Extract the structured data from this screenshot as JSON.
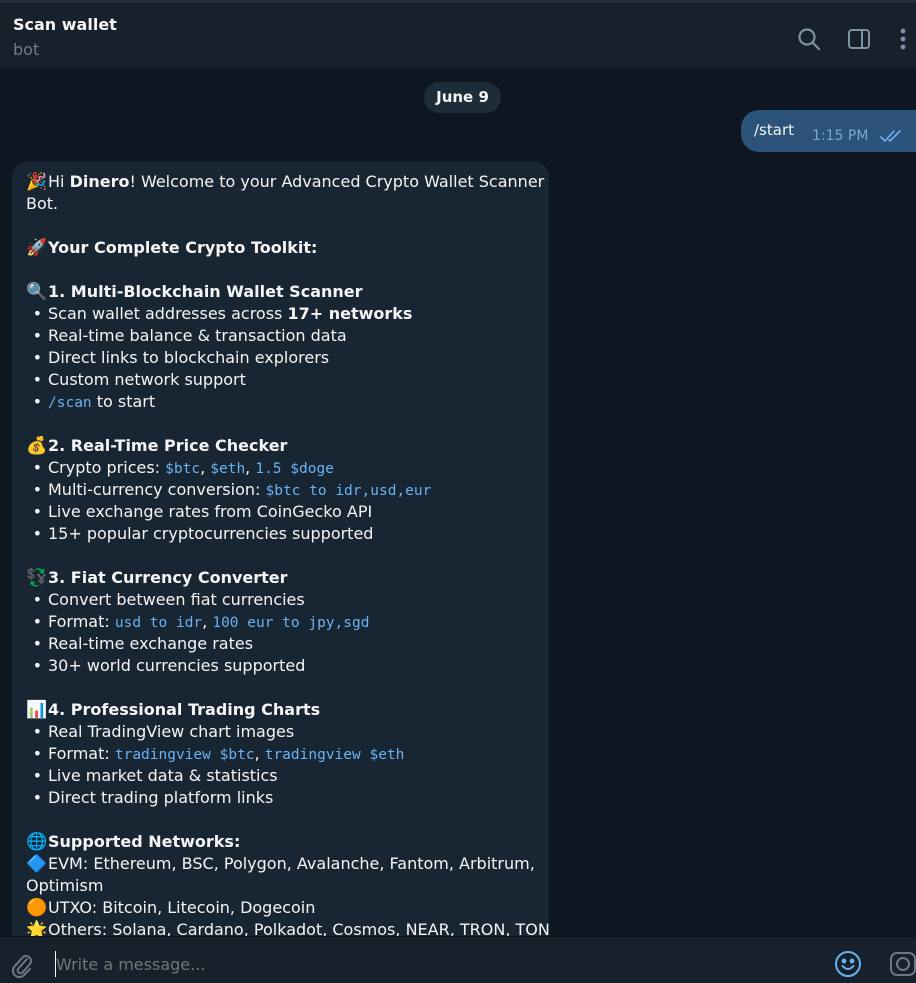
{
  "header": {
    "title": "Scan wallet",
    "subtitle": "bot"
  },
  "chat": {
    "date_label": "June 9",
    "outgoing": {
      "text": "/start",
      "time": "1:15 PM"
    },
    "incoming": {
      "greeting_emoji": "🎉",
      "greeting_pre": "Hi ",
      "greeting_name": "Dinero",
      "greeting_post": "! Welcome to your Advanced Crypto Wallet Scanner",
      "greeting_cont": "Bot.",
      "toolkit_emoji": "🚀",
      "toolkit_title": "Your Complete Crypto Toolkit:",
      "s1_emoji": "🔍",
      "s1_title": "1. Multi-Blockchain Wallet Scanner",
      "s1_b1_pre": "Scan wallet addresses across ",
      "s1_b1_bold": "17+ networks",
      "s1_b2": "Real-time balance & transaction data",
      "s1_b3": "Direct links to blockchain explorers",
      "s1_b4": "Custom network support",
      "s1_b5_code": "/scan",
      "s1_b5_post": " to start",
      "s2_emoji": "💰",
      "s2_title": "2. Real-Time Price Checker",
      "s2_b1_pre": "Crypto prices: ",
      "s2_b1_c1": "$btc",
      "s2_b1_c2": "$eth",
      "s2_b1_c3": "1.5 $doge",
      "s2_b2_pre": "Multi-currency conversion: ",
      "s2_b2_code": "$btc to idr,usd,eur",
      "s2_b3": "Live exchange rates from CoinGecko API",
      "s2_b4": "15+ popular cryptocurrencies supported",
      "s3_emoji": "💱",
      "s3_title": "3. Fiat Currency Converter",
      "s3_b1": "Convert between fiat currencies",
      "s3_b2_pre": "Format: ",
      "s3_b2_c1": "usd to idr",
      "s3_b2_c2": "100 eur to jpy,sgd",
      "s3_b3": "Real-time exchange rates",
      "s3_b4": "30+ world currencies supported",
      "s4_emoji": "📊",
      "s4_title": "4. Professional Trading Charts",
      "s4_b1": "Real TradingView chart images",
      "s4_b2_pre": "Format: ",
      "s4_b2_c1": "tradingview $btc",
      "s4_b2_c2": "tradingview $eth",
      "s4_b3": "Live market data & statistics",
      "s4_b4": "Direct trading platform links",
      "net_emoji": "🌐",
      "net_title": "Supported Networks:",
      "evm_emoji": "🔷",
      "evm_text": "EVM: Ethereum, BSC, Polygon, Avalanche, Fantom, Arbitrum,",
      "evm_cont": "Optimism",
      "utxo_emoji": "🟠",
      "utxo_text": "UTXO: Bitcoin, Litecoin, Dogecoin",
      "oth_emoji": "🌟",
      "oth_text": "Others: Solana, Cardano, Polkadot, Cosmos, NEAR, TRON, TON",
      "bullet": "•",
      "comma": ", "
    }
  },
  "composer": {
    "placeholder": "Write a message..."
  }
}
